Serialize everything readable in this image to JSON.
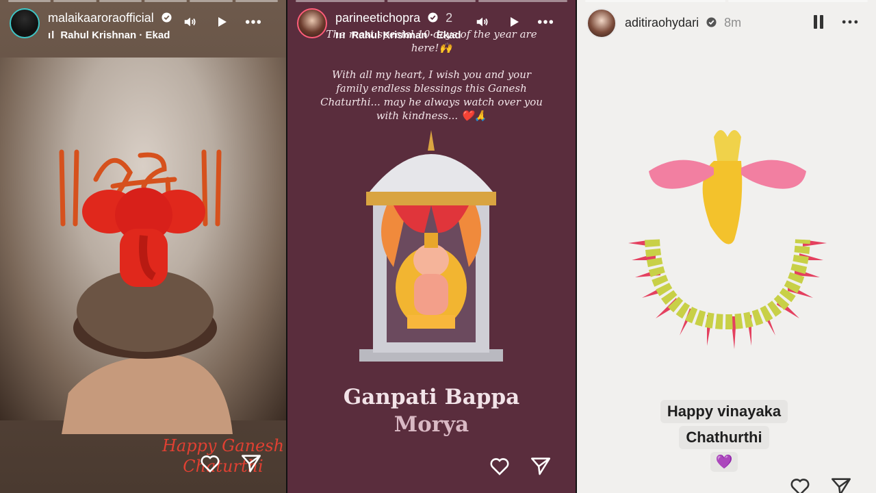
{
  "stories": [
    {
      "username": "malaikaaroraofficial",
      "music": "Rahul Krishnan · Ekad",
      "caption": [
        "Happy Ganesh",
        "Chaturthi"
      ],
      "shri_text": "॥ श्री ॥"
    },
    {
      "username": "parineetichoрra",
      "time": "2",
      "music": "Rahul Krishnan · Ekad",
      "text_top": "The most special 10 days of the year are here!🙌",
      "text_body": "With all my heart, I wish you and your family endless blessings this Ganesh Chaturthi... may he always watch over you with kindness... ❤️🙏",
      "title_line1": "Ganpati Bappa",
      "title_line2": "Morya"
    },
    {
      "username": "aditiraohydari",
      "time": "8m",
      "sticker_line1": "Happy vinayaka",
      "sticker_line2": "Chathurthi",
      "sticker_emoji": "💜"
    }
  ],
  "icons": [
    "sound-icon",
    "play-icon",
    "more-icon",
    "pause-icon",
    "heart-icon",
    "send-icon",
    "verified-icon"
  ],
  "colors": {
    "s1_bg": "#4a3a30",
    "s2_bg": "#5a2d3d",
    "s3_bg": "#f1f0ee",
    "ganesha_red": "#e0281c",
    "verified_blue": "#3897f0"
  }
}
